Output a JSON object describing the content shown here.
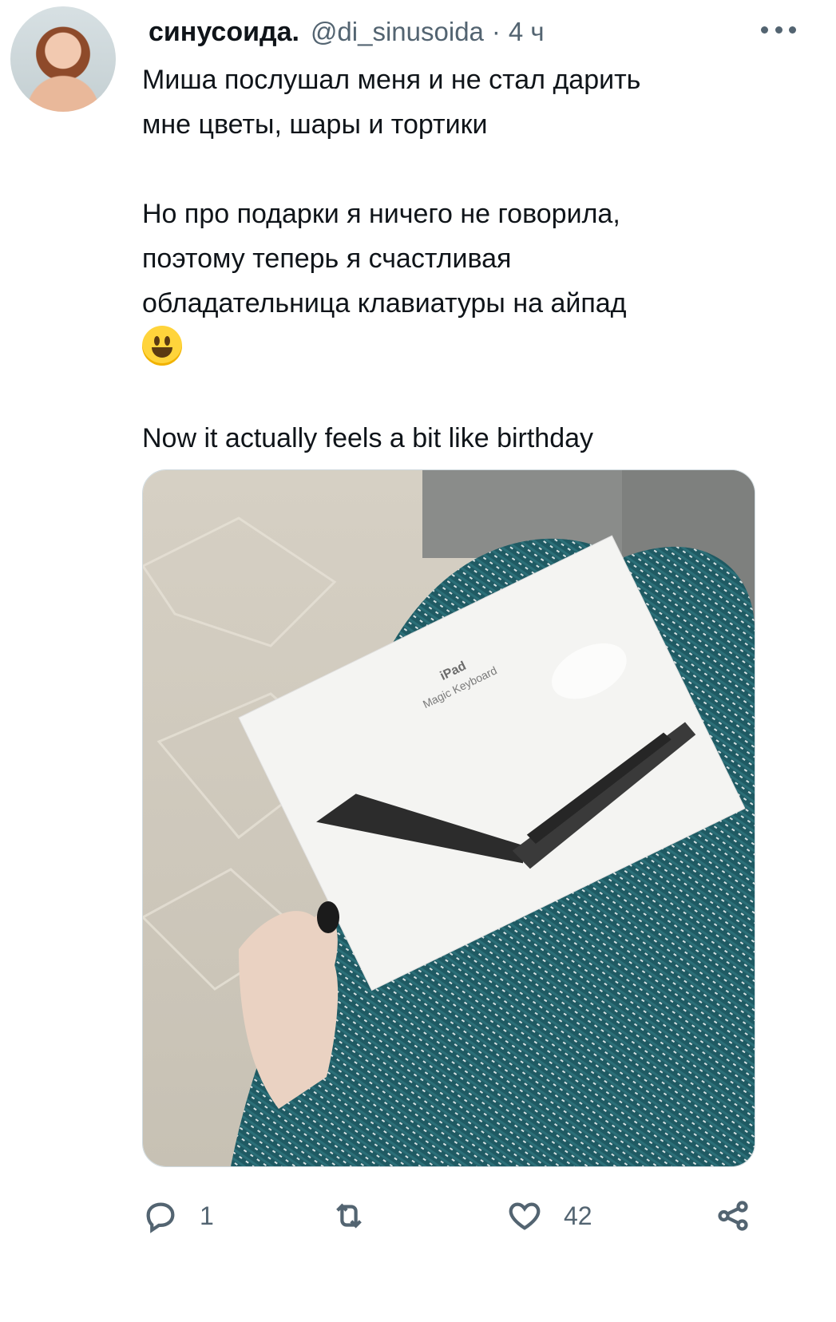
{
  "post": {
    "author_name": "синусоида.",
    "author_handle": "@di_sinusoida",
    "separator": "·",
    "time": "4 ч",
    "text_part1": "Миша послушал меня и не стал дарить\nмне цветы, шары и тортики\n\nНо про подарки я ничего не говорила,\nпоэтому теперь я счастливая\nобладательница клавиатуры на айпад\n",
    "emoji_name": "grinning-face-emoji",
    "text_part2": "\n\nNow it actually feels a bit like birthday",
    "media": {
      "box_brand": "iPad",
      "box_product": "Magic Keyboard"
    }
  },
  "actions": {
    "reply": {
      "icon": "reply-icon",
      "count": "1"
    },
    "repost": {
      "icon": "repost-icon",
      "count": ""
    },
    "like": {
      "icon": "heart-icon",
      "count": "42"
    },
    "share": {
      "icon": "share-icon"
    }
  },
  "colors": {
    "text": "#0f1419",
    "secondary": "#536471"
  }
}
